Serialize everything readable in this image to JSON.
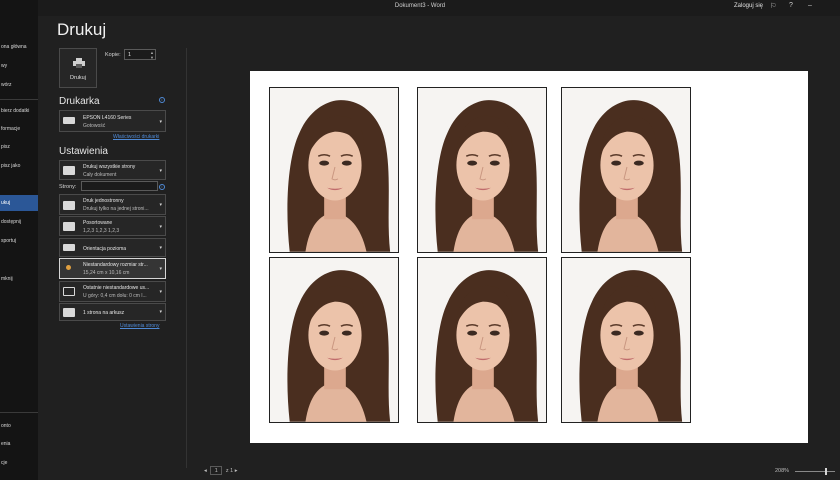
{
  "titlebar": {
    "document_title": "Dokument3 - Word",
    "sign_in": "Zaloguj się",
    "icons": [
      "coauthor-icon",
      "help-icon",
      "minimize-icon"
    ]
  },
  "nav": {
    "items": [
      {
        "label": "ona główna",
        "state": "normal"
      },
      {
        "label": "wy",
        "state": "normal"
      },
      {
        "label": "wórz",
        "state": "normal"
      },
      {
        "label": "bierz dodatki",
        "state": "normal"
      },
      {
        "label": "formacje",
        "state": "normal"
      },
      {
        "label": "pisz",
        "state": "normal"
      },
      {
        "label": "pisz jako",
        "state": "normal"
      },
      {
        "label": "",
        "state": "dim"
      },
      {
        "label": "ukuj",
        "state": "active"
      },
      {
        "label": "dostępnij",
        "state": "normal"
      },
      {
        "label": "sportuj",
        "state": "normal"
      },
      {
        "label": "",
        "state": "dim"
      },
      {
        "label": "mknij",
        "state": "normal"
      }
    ],
    "bottom_items": [
      "onto",
      "enia",
      "cje"
    ]
  },
  "print": {
    "title": "Drukuj",
    "print_button": "Drukuj",
    "copies_label": "Kopie:",
    "copies_value": "1"
  },
  "printer": {
    "heading": "Drukarka",
    "name": "EPSON L4160 Series",
    "status": "Gotowość",
    "properties_link": "Właściwości drukarki"
  },
  "settings": {
    "heading": "Ustawienia",
    "pages_label": "Strony:",
    "pages_value": "",
    "options": [
      {
        "line1": "Drukuj wszystkie strony",
        "line2": "Cały dokument"
      },
      {
        "line1": "Druk jednostronny",
        "line2": "Drukuj tylko na jednej stroni..."
      },
      {
        "line1": "Posortowane",
        "line2": "1,2,3    1,2,3    1,2,3"
      },
      {
        "line1": "Orientacja pozioma",
        "line2": ""
      },
      {
        "line1": "Niestandardowy rozmiar str...",
        "line2": "15,24  cm x 10,16  cm"
      },
      {
        "line1": "Ostatnie niestandardowe us...",
        "line2": "U góry: 0,4  cm dołu: 0  cm l..."
      },
      {
        "line1": "1 strona na arkusz",
        "line2": ""
      }
    ],
    "page_setup_link": "Ustawienia strony"
  },
  "preview": {
    "photos_count_label": ""
  },
  "status": {
    "current_page": "1",
    "of_pages": "z 1",
    "zoom": "208%"
  }
}
